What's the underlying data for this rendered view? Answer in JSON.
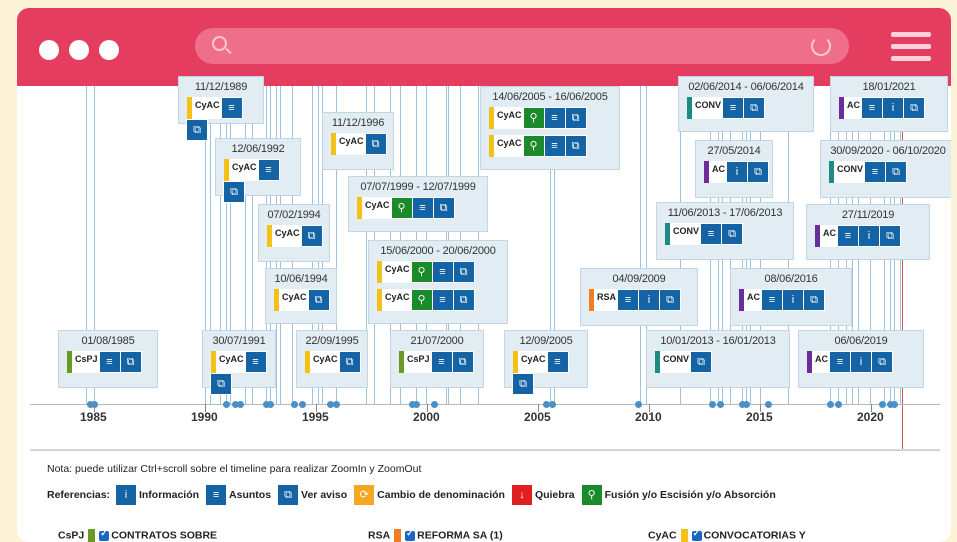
{
  "browser": {
    "search_placeholder": ""
  },
  "timeline": {
    "years": [
      "1985",
      "1990",
      "1995",
      "2000",
      "2005",
      "2010",
      "2015",
      "2020"
    ],
    "cards": [
      {
        "date": "11/12/1989",
        "chips": [
          {
            "label": "CyAC",
            "cat": "cyac",
            "buttons": [
              "list",
              "link"
            ]
          }
        ]
      },
      {
        "date": "12/06/1992",
        "chips": [
          {
            "label": "CyAC",
            "cat": "cyac",
            "buttons": [
              "list",
              "link"
            ]
          }
        ]
      },
      {
        "date": "07/02/1994",
        "chips": [
          {
            "label": "CyAC",
            "cat": "cyac",
            "buttons": [
              "link"
            ]
          }
        ]
      },
      {
        "date": "10/06/1994",
        "chips": [
          {
            "label": "CyAC",
            "cat": "cyac",
            "buttons": [
              "link"
            ]
          }
        ]
      },
      {
        "date": "01/08/1985",
        "chips": [
          {
            "label": "CsPJ",
            "cat": "cspj",
            "buttons": [
              "list",
              "link"
            ]
          }
        ]
      },
      {
        "date": "30/07/1991",
        "chips": [
          {
            "label": "CyAC",
            "cat": "cyac",
            "buttons": [
              "list",
              "link"
            ]
          }
        ]
      },
      {
        "date": "22/09/1995",
        "chips": [
          {
            "label": "CyAC",
            "cat": "cyac",
            "buttons": [
              "link"
            ]
          }
        ]
      },
      {
        "date": "11/12/1996",
        "chips": [
          {
            "label": "CyAC",
            "cat": "cyac",
            "buttons": [
              "link"
            ]
          }
        ]
      },
      {
        "date": "07/07/1999 - 12/07/1999",
        "chips": [
          {
            "label": "CyAC",
            "cat": "cyac",
            "buttons": [
              "fusion",
              "list",
              "link"
            ]
          }
        ]
      },
      {
        "date": "15/06/2000 - 20/06/2000",
        "chips": [
          {
            "label": "CyAC",
            "cat": "cyac",
            "buttons": [
              "fusion",
              "list",
              "link"
            ]
          },
          {
            "label": "CyAC",
            "cat": "cyac",
            "buttons": [
              "fusion",
              "list",
              "link"
            ]
          }
        ]
      },
      {
        "date": "21/07/2000",
        "chips": [
          {
            "label": "CsPJ",
            "cat": "cspj",
            "buttons": [
              "list",
              "link"
            ]
          }
        ]
      },
      {
        "date": "14/06/2005 - 16/06/2005",
        "chips": [
          {
            "label": "CyAC",
            "cat": "cyac",
            "buttons": [
              "fusion",
              "list",
              "link"
            ]
          },
          {
            "label": "CyAC",
            "cat": "cyac",
            "buttons": [
              "fusion",
              "list",
              "link"
            ]
          }
        ]
      },
      {
        "date": "12/09/2005",
        "chips": [
          {
            "label": "CyAC",
            "cat": "cyac",
            "buttons": [
              "list",
              "link"
            ]
          }
        ]
      },
      {
        "date": "04/09/2009",
        "chips": [
          {
            "label": "RSA",
            "cat": "rsa",
            "buttons": [
              "list",
              "info",
              "link"
            ]
          }
        ]
      },
      {
        "date": "10/01/2013 - 16/01/2013",
        "chips": [
          {
            "label": "CONV",
            "cat": "conv",
            "buttons": [
              "link"
            ]
          }
        ]
      },
      {
        "date": "11/06/2013 - 17/06/2013",
        "chips": [
          {
            "label": "CONV",
            "cat": "conv",
            "buttons": [
              "list",
              "link"
            ]
          }
        ]
      },
      {
        "date": "02/06/2014 - 06/06/2014",
        "chips": [
          {
            "label": "CONV",
            "cat": "conv",
            "buttons": [
              "list",
              "link"
            ]
          }
        ]
      },
      {
        "date": "27/05/2014",
        "chips": [
          {
            "label": "AC",
            "cat": "ac",
            "buttons": [
              "info",
              "link"
            ]
          }
        ]
      },
      {
        "date": "08/06/2016",
        "chips": [
          {
            "label": "AC",
            "cat": "ac",
            "buttons": [
              "list",
              "info",
              "link"
            ]
          }
        ]
      },
      {
        "date": "27/11/2019",
        "chips": [
          {
            "label": "AC",
            "cat": "ac",
            "buttons": [
              "list",
              "info",
              "link"
            ]
          }
        ]
      },
      {
        "date": "30/09/2020 - 06/10/2020",
        "chips": [
          {
            "label": "CONV",
            "cat": "conv",
            "buttons": [
              "list",
              "link"
            ]
          }
        ]
      },
      {
        "date": "18/01/2021",
        "chips": [
          {
            "label": "AC",
            "cat": "ac",
            "buttons": [
              "list",
              "info",
              "link"
            ]
          }
        ]
      },
      {
        "date": "06/06/2019",
        "chips": [
          {
            "label": "AC",
            "cat": "ac",
            "buttons": [
              "list",
              "info",
              "link"
            ]
          }
        ]
      }
    ]
  },
  "legend": {
    "note": "Nota: puede utilizar Ctrl+scroll sobre el timeline para realizar ZoomIn y ZoomOut",
    "refs_label": "Referencias:",
    "refs": [
      {
        "icon": "info-icon",
        "label": "Información",
        "color": "#1464a5",
        "glyph": "i"
      },
      {
        "icon": "list-icon",
        "label": "Asuntos",
        "color": "#1464a5",
        "glyph": "≡"
      },
      {
        "icon": "external-link-icon",
        "label": "Ver aviso",
        "color": "#1464a5",
        "glyph": "⧉"
      },
      {
        "icon": "rename-icon",
        "label": "Cambio de denominación",
        "color": "#f5a623",
        "glyph": "⟳"
      },
      {
        "icon": "arrow-down-icon",
        "label": "Quiebra",
        "color": "#e02020",
        "glyph": "↓"
      },
      {
        "icon": "fusion-icon",
        "label": "Fusión y/o Escisión y/o Absorción",
        "color": "#1b8a2b",
        "glyph": "⚲"
      }
    ],
    "categories": [
      {
        "code": "CsPJ",
        "label": "CONTRATOS SOBRE",
        "color": "#6a9a23"
      },
      {
        "code": "RSA",
        "label": "REFORMA SA (1)",
        "color": "#f07e26"
      },
      {
        "code": "CyAC",
        "label": "CONVOCATORIAS Y",
        "color": "#f2c316"
      }
    ]
  }
}
